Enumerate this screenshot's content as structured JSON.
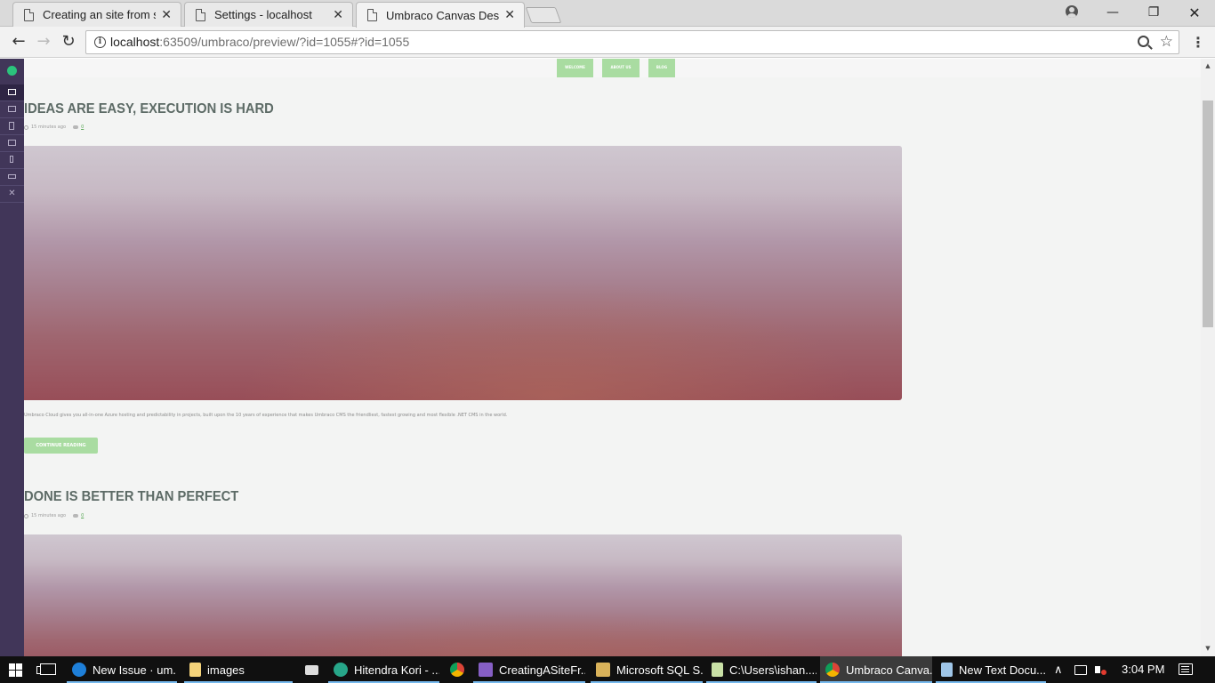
{
  "browser": {
    "tabs": [
      {
        "title": "Creating an site from scratch"
      },
      {
        "title": "Settings - localhost"
      },
      {
        "title": "Umbraco Canvas Designer"
      }
    ],
    "close_glyph": "✕",
    "window_controls": {
      "minimize": "—",
      "maximize": "❐",
      "close": "✕"
    },
    "nav": {
      "back": "←",
      "forward": "→",
      "reload": "↻"
    },
    "url_host": "localhost",
    "url_rest": ":63509/umbraco/preview/?id=1055#?id=1055",
    "star": "☆",
    "menu": "⋮"
  },
  "canvas_designer": {
    "buttons": [
      "desktop-icon",
      "laptop-icon",
      "tablet-icon",
      "tablet-landscape-icon",
      "phone-icon",
      "phone-landscape-icon"
    ],
    "close_glyph": "✕",
    "accent": "#2bc37c"
  },
  "site": {
    "nav": [
      "WELCOME",
      "ABOUT US",
      "BLOG"
    ],
    "accent": "#a9dca1",
    "posts": [
      {
        "title": "IDEAS ARE EASY, EXECUTION IS HARD",
        "time": "15 minutes ago",
        "comments": "0",
        "excerpt": "Umbraco Cloud gives you all-in-one Azure hosting and predictability in projects, built upon the 10 years of experience that makes Umbraco CMS the friendliest, fastest growing and most flexible .NET CMS in the world.",
        "cta": "CONTINUE READING"
      },
      {
        "title": "DONE IS BETTER THAN PERFECT",
        "time": "15 minutes ago",
        "comments": "0"
      }
    ]
  },
  "scrollbar": {
    "up": "▲",
    "down": "▼"
  },
  "taskbar": {
    "items": [
      {
        "label": "New Issue · um...",
        "icon": "edge-icon"
      },
      {
        "label": "images",
        "icon": "folder-icon"
      },
      {
        "label": "",
        "icon": "mail-icon"
      },
      {
        "label": "Hitendra Kori - ...",
        "icon": "app-icon"
      },
      {
        "label": "",
        "icon": "chrome-icon"
      },
      {
        "label": "CreatingASiteFr...",
        "icon": "visual-studio-icon"
      },
      {
        "label": "Microsoft SQL S...",
        "icon": "sql-server-icon"
      },
      {
        "label": "C:\\Users\\ishan....",
        "icon": "notepad-icon"
      },
      {
        "label": "Umbraco Canva...",
        "icon": "chrome-icon"
      },
      {
        "label": "New Text Docu...",
        "icon": "notepad-icon"
      }
    ],
    "tray": {
      "chevron": "∧",
      "time": "3:04 PM"
    }
  }
}
